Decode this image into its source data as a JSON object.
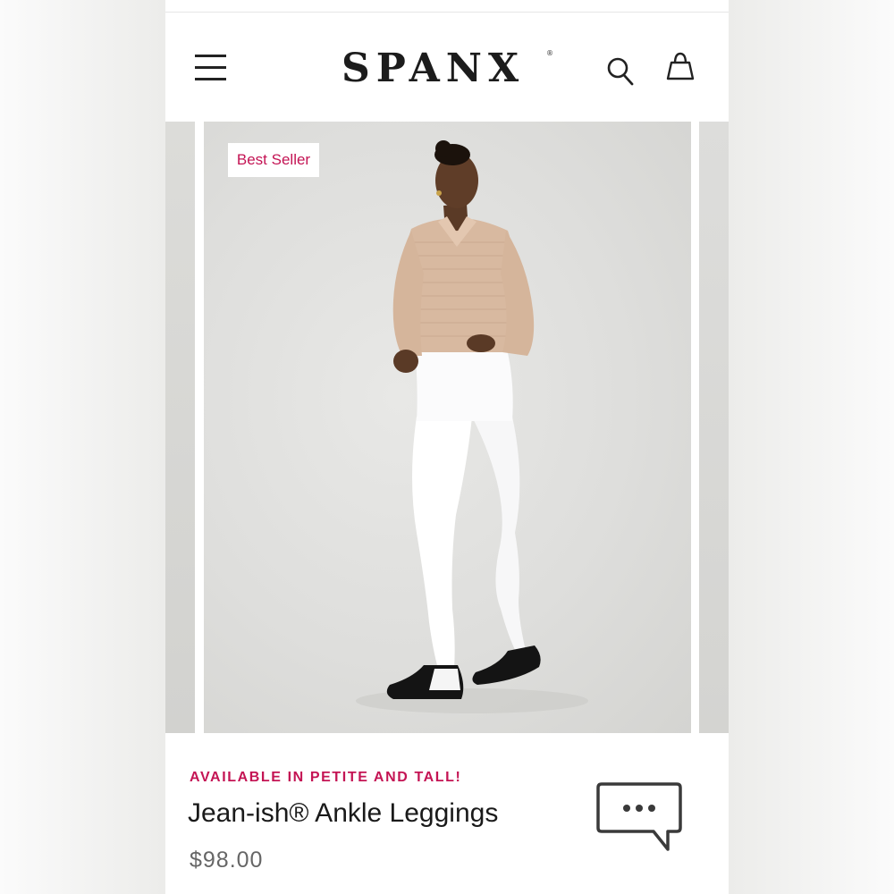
{
  "header": {
    "brand": "SPANX",
    "brand_mark": "®",
    "menu_icon": "hamburger-menu-icon",
    "search_icon": "search-icon",
    "bag_icon": "shopping-bag-icon"
  },
  "carousel": {
    "badge": "Best Seller"
  },
  "product": {
    "promo": "AVAILABLE IN PETITE AND TALL!",
    "title": "Jean-ish® Ankle Leggings",
    "price": "$98.00"
  },
  "chat": {
    "icon": "chat-bubble-icon"
  },
  "colors": {
    "accent": "#c41454",
    "text": "#1a1a1a",
    "price": "#666666"
  }
}
